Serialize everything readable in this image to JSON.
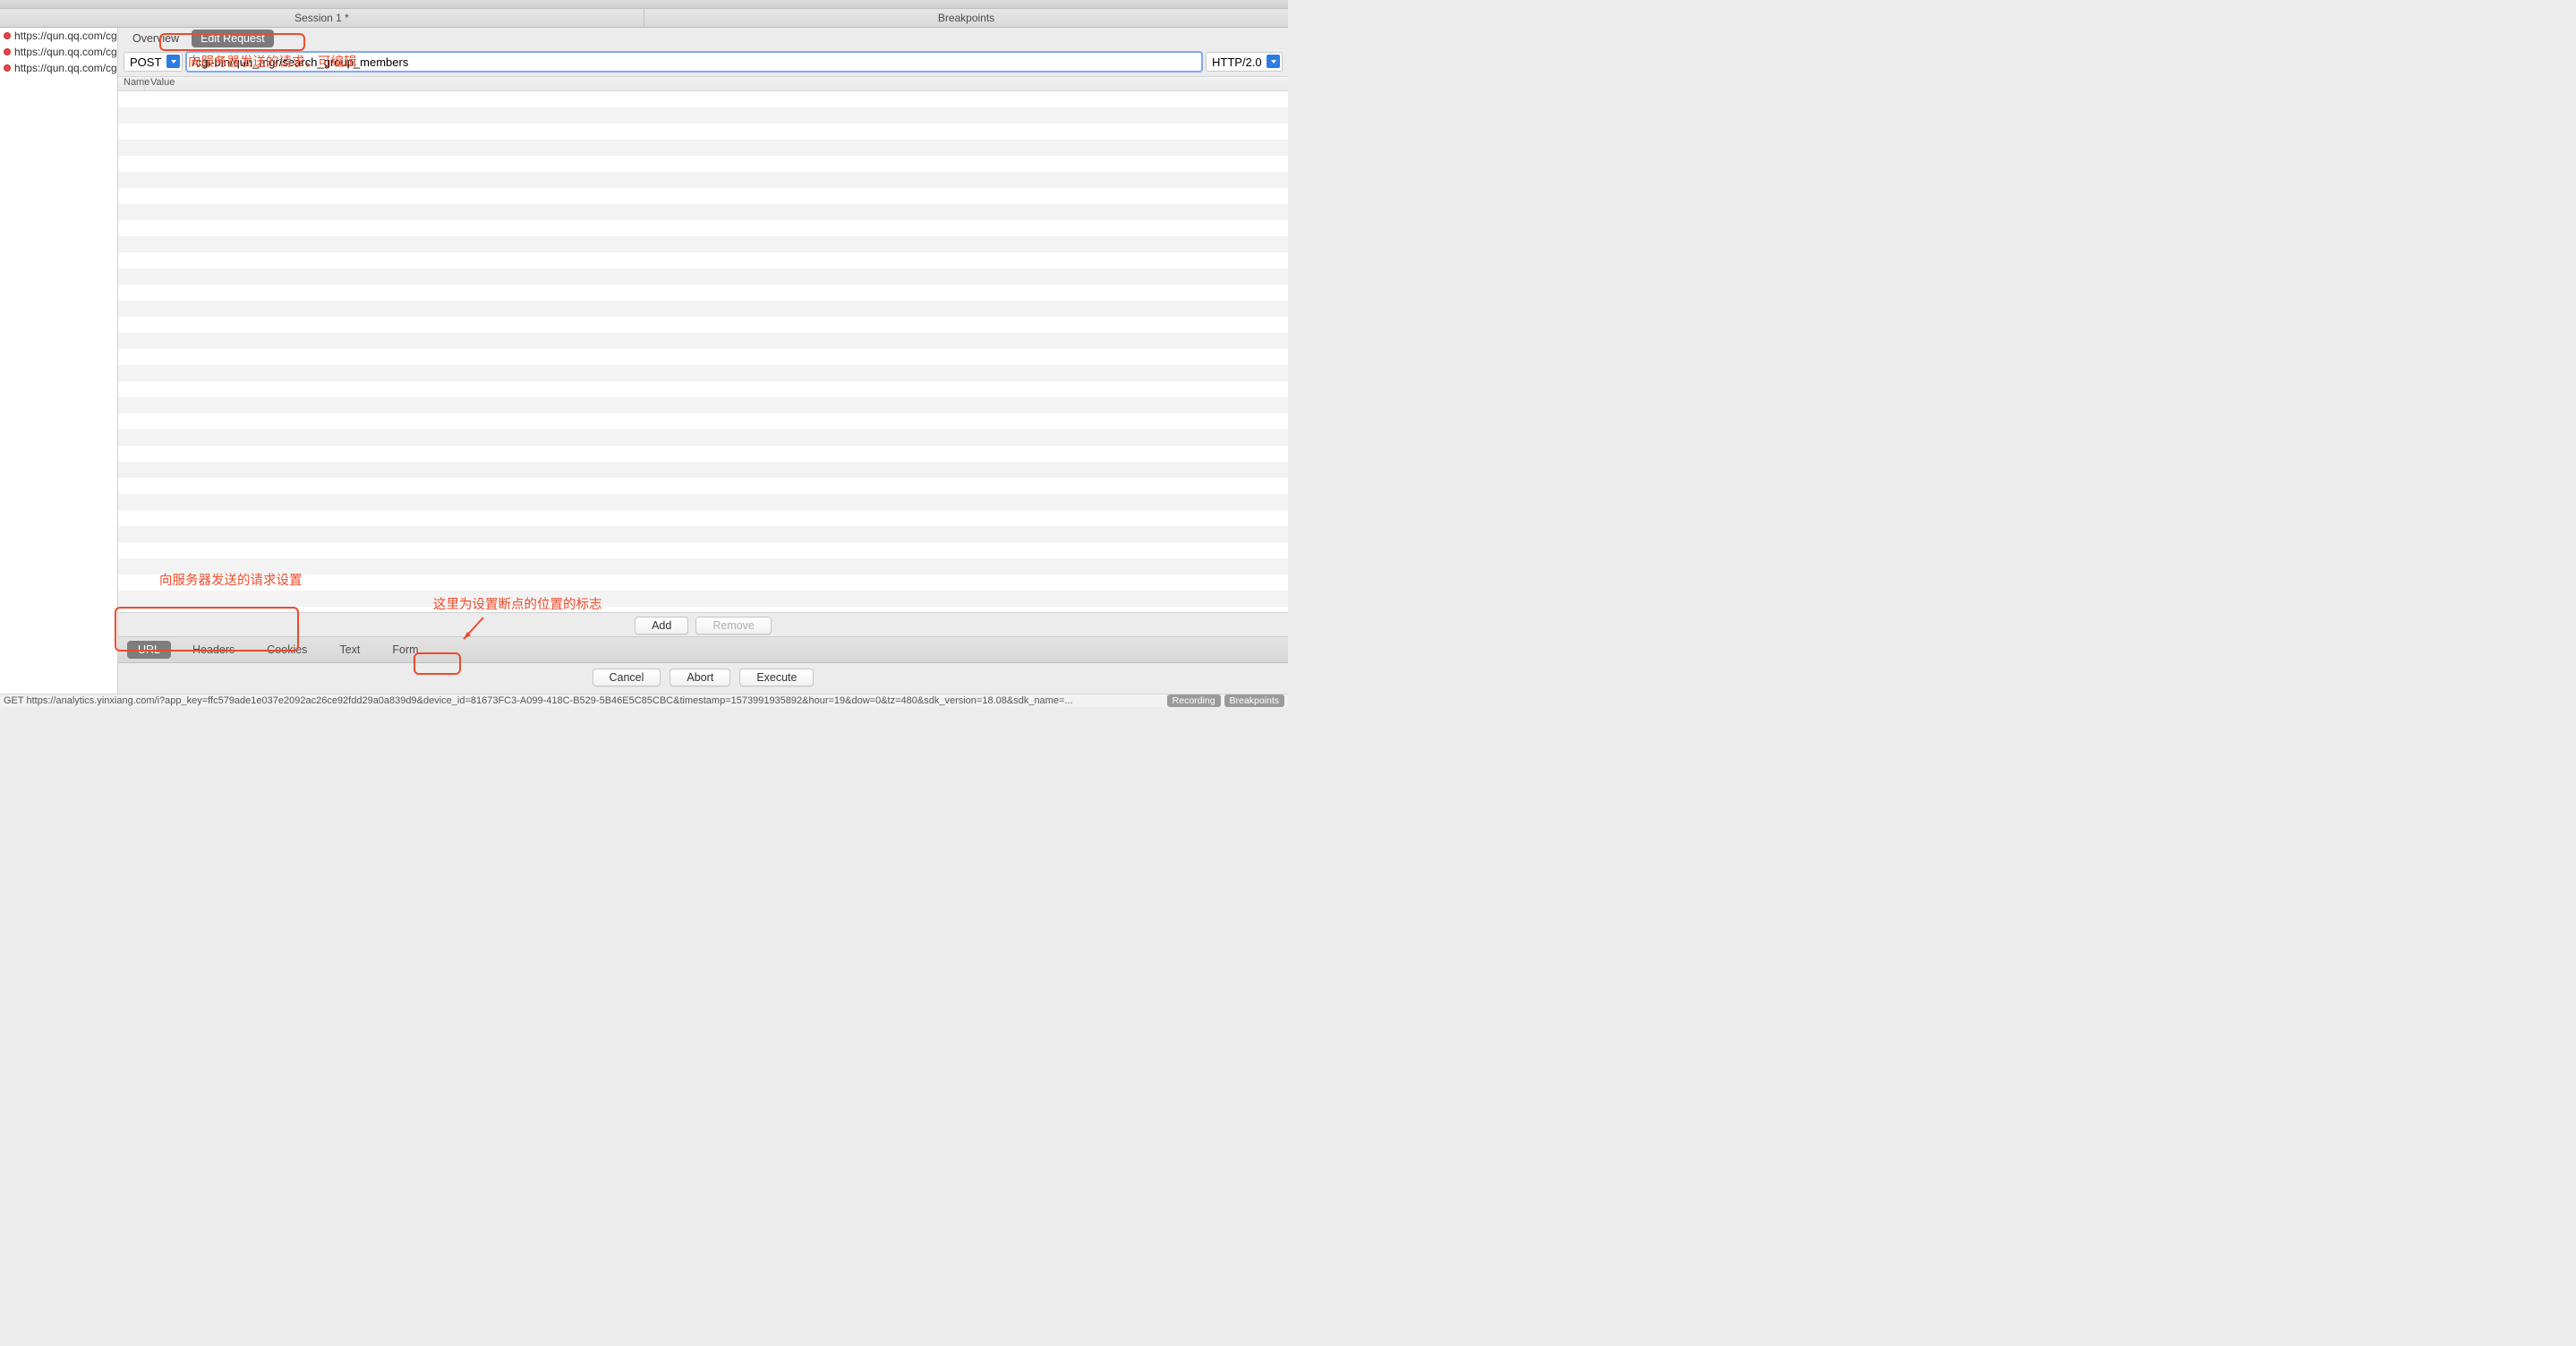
{
  "header": {
    "tab_left": "Session 1 *",
    "tab_right": "Breakpoints"
  },
  "session_list": [
    "https://qun.qq.com/cgi-bin/qun_mgr/sea",
    "https://qun.qq.com/cgi-bin/qun_mgr/sea",
    "https://qun.qq.com/cgi-bin/qun_mgr/sea"
  ],
  "sub_tabs": {
    "overview": "Overview",
    "edit_request": "Edit Request"
  },
  "request": {
    "method": "POST",
    "url": "/cgi-bin/qun_mgr/search_group_members",
    "protocol": "HTTP/2.0"
  },
  "nv_header": {
    "name": "Name",
    "value": "Value"
  },
  "buttons": {
    "add": "Add",
    "remove": "Remove",
    "cancel": "Cancel",
    "abort": "Abort",
    "execute": "Execute"
  },
  "lower_tabs": {
    "url": "URL",
    "headers": "Headers",
    "cookies": "Cookies",
    "text": "Text",
    "form": "Form"
  },
  "status_bar": {
    "text": "GET https://analytics.yinxiang.com/i?app_key=ffc579ade1e037e2092ac26ce92fdd29a0a839d9&device_id=81673FC3-A099-418C-B529-5B46E5C85CBC&timestamp=1573991935892&hour=19&dow=0&tz=480&sdk_version=18.08&sdk_name=...",
    "badge_recording": "Recording",
    "badge_breakpoints": "Breakpoints"
  },
  "annotations": {
    "a1": "向服务器发送的请求，可编辑",
    "a2": "向服务器发送的请求设置",
    "a3": "这里为设置断点的位置的标志"
  }
}
